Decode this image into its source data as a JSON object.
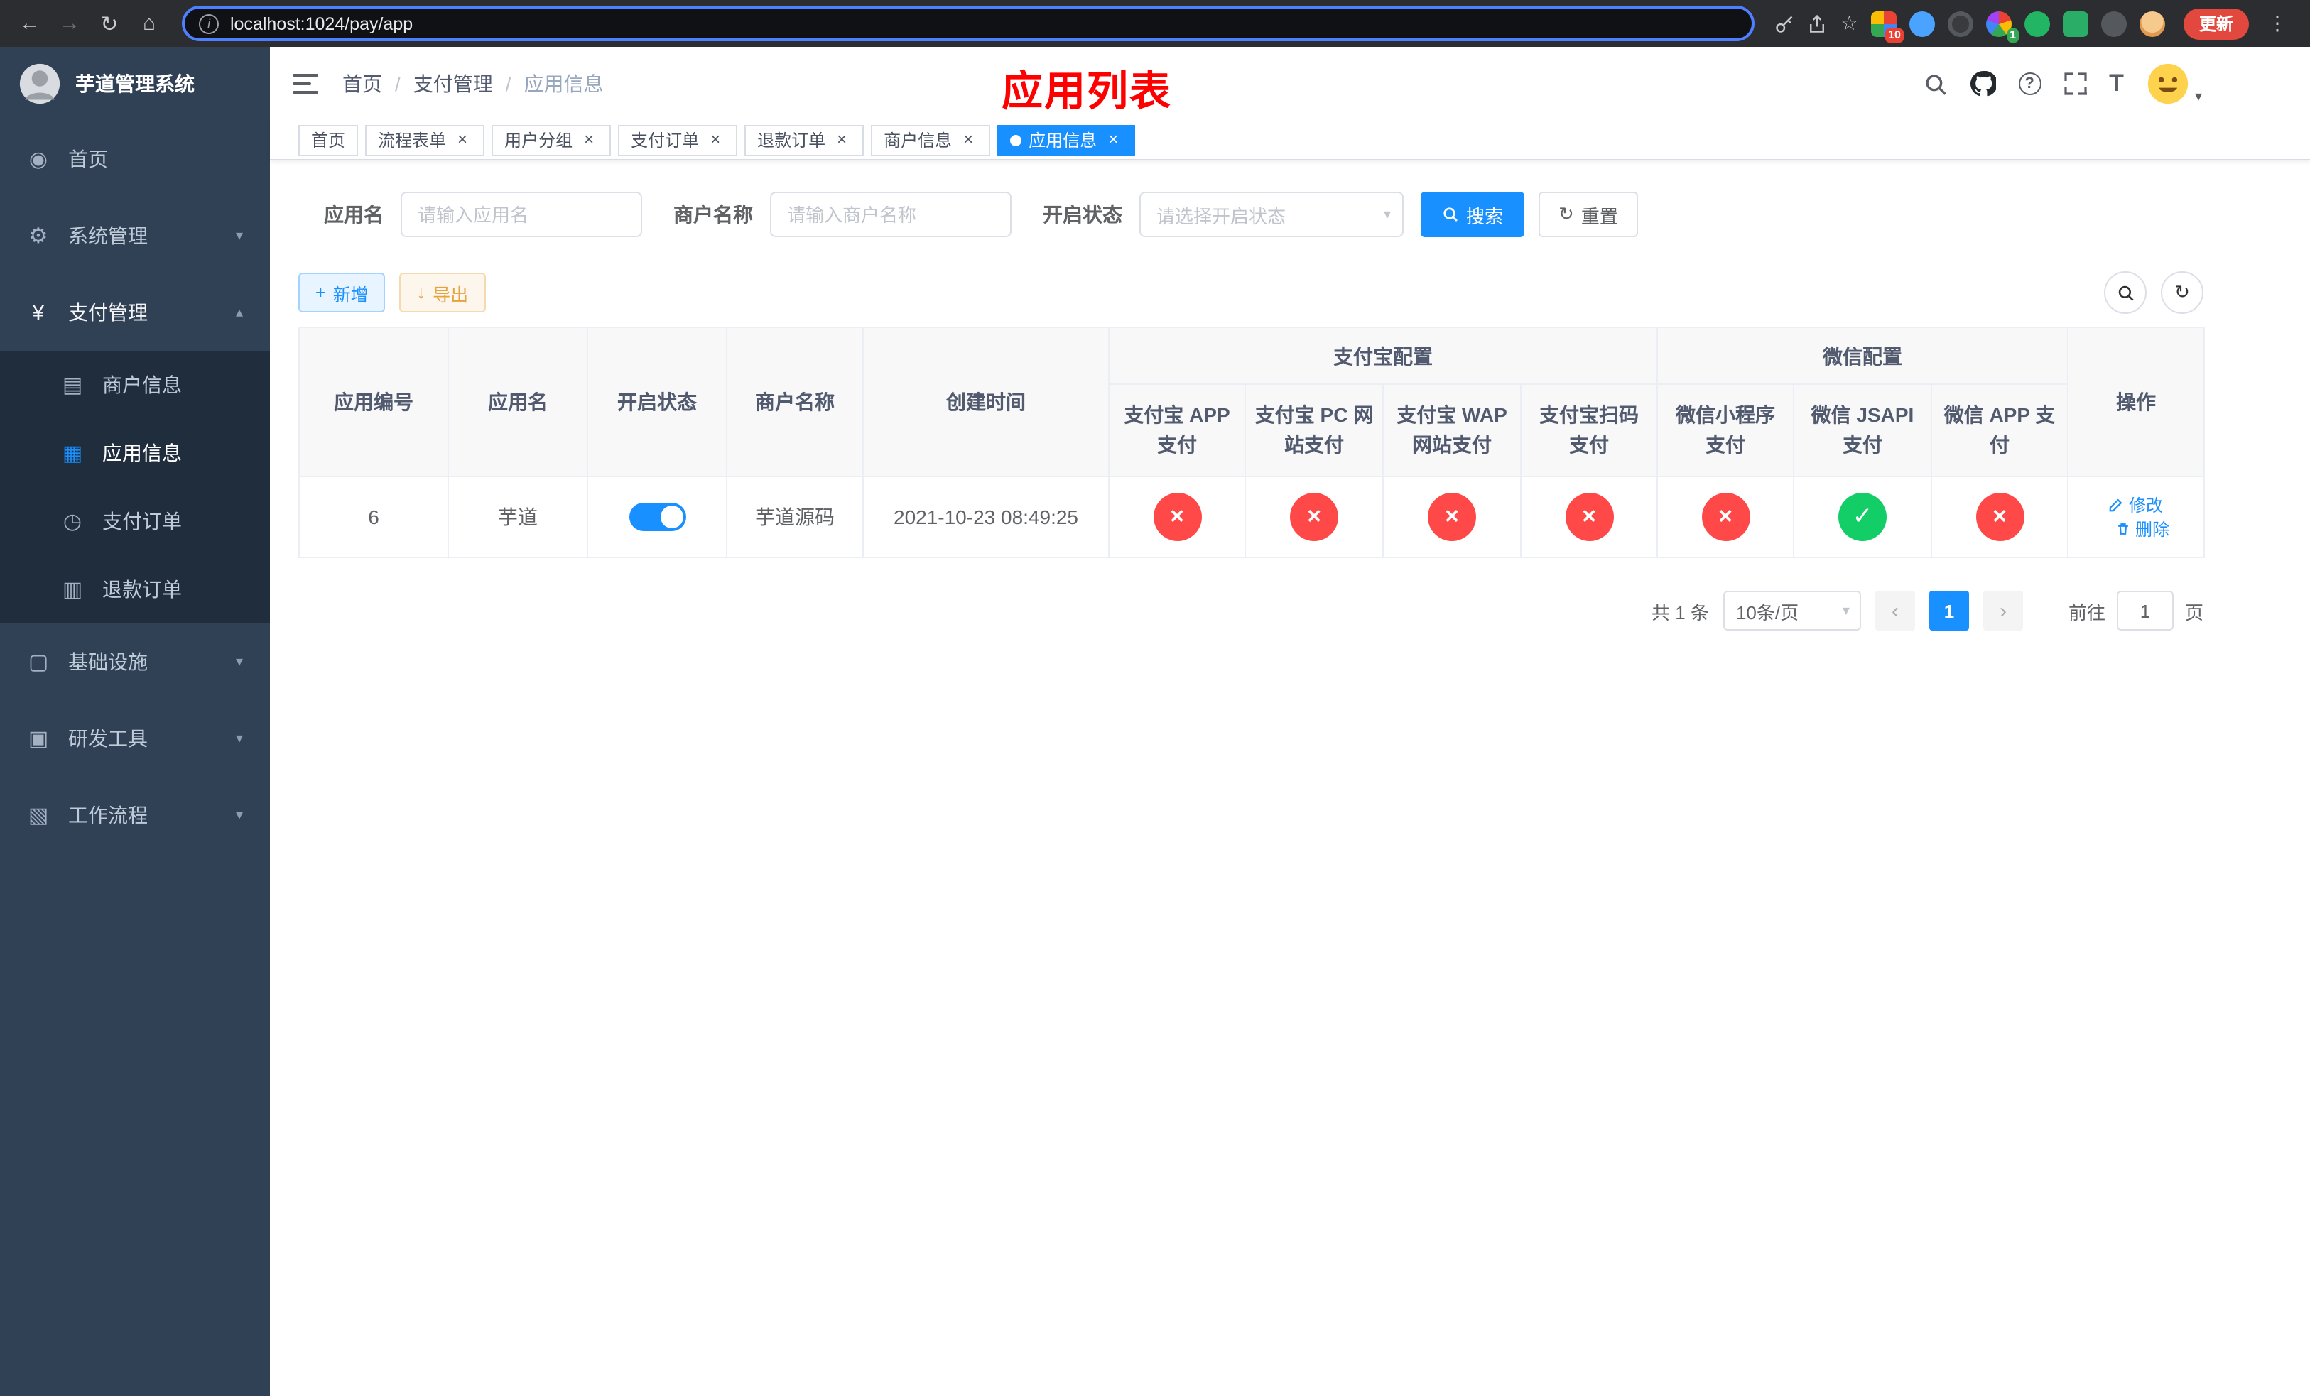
{
  "colors": {
    "primary": "#1890ff",
    "danger": "#ff4949",
    "success": "#13ce66",
    "warning": "#e6a23c",
    "annotation": "#ff0000"
  },
  "browser": {
    "url": "localhost:1024/pay/app",
    "update_button": "更新",
    "ext_badge_grid": "10",
    "ext_badge_wheel": "1"
  },
  "icons": {
    "back": "←",
    "forward": "→",
    "reload": "↻",
    "home": "⌂",
    "info": "i",
    "star": "☆",
    "dots": "⋮",
    "sep": "/",
    "chevron_down": "▾",
    "chevron_up": "▴",
    "caret": "▾",
    "close": "×",
    "cross": "×",
    "check": "✓",
    "prev": "‹",
    "next": "›",
    "plus": "+",
    "download": "↓",
    "refresh": "↻",
    "question": "?",
    "text_size": "T",
    "menu_home": "◉",
    "menu_system": "⚙",
    "menu_pay": "¥",
    "menu_merchant": "▤",
    "menu_app": "▦",
    "menu_pay_order": "◷",
    "menu_refund": "▥",
    "menu_infra": "▢",
    "menu_tools": "▣",
    "menu_flow": "▧"
  },
  "sidebar": {
    "title": "芋道管理系统",
    "menu": [
      {
        "label": "首页"
      },
      {
        "label": "系统管理"
      },
      {
        "label": "支付管理"
      },
      {
        "label": "商户信息"
      },
      {
        "label": "应用信息"
      },
      {
        "label": "支付订单"
      },
      {
        "label": "退款订单"
      },
      {
        "label": "基础设施"
      },
      {
        "label": "研发工具"
      },
      {
        "label": "工作流程"
      }
    ]
  },
  "navbar": {
    "breadcrumb": [
      {
        "label": "首页"
      },
      {
        "label": "支付管理"
      },
      {
        "label": "应用信息"
      }
    ],
    "annotation": "应用列表"
  },
  "tabs": [
    {
      "label": "首页",
      "closable": false,
      "active": false
    },
    {
      "label": "流程表单",
      "closable": true,
      "active": false
    },
    {
      "label": "用户分组",
      "closable": true,
      "active": false
    },
    {
      "label": "支付订单",
      "closable": true,
      "active": false
    },
    {
      "label": "退款订单",
      "closable": true,
      "active": false
    },
    {
      "label": "商户信息",
      "closable": true,
      "active": false
    },
    {
      "label": "应用信息",
      "closable": true,
      "active": true
    }
  ],
  "filters": {
    "app_name_label": "应用名",
    "app_name_placeholder": "请输入应用名",
    "merchant_label": "商户名称",
    "merchant_placeholder": "请输入商户名称",
    "status_label": "开启状态",
    "status_placeholder": "请选择开启状态",
    "search_button": "搜索",
    "reset_button": "重置"
  },
  "toolbar": {
    "add_button": "新增",
    "export_button": "导出"
  },
  "table": {
    "group_headers": {
      "alipay": "支付宝配置",
      "wechat": "微信配置"
    },
    "columns": {
      "app_id": "应用编号",
      "app_name": "应用名",
      "status": "开启状态",
      "merchant_name": "商户名称",
      "create_time": "创建时间",
      "alipay_app": "支付宝 APP 支付",
      "alipay_pc": "支付宝 PC 网站支付",
      "alipay_wap": "支付宝 WAP 网站支付",
      "alipay_qr": "支付宝扫码支付",
      "wx_mini": "微信小程序支付",
      "wx_jsapi": "微信 JSAPI 支付",
      "wx_app": "微信 APP 支付",
      "actions": "操作"
    },
    "rows": [
      {
        "app_id": "6",
        "app_name": "芋道",
        "status_enabled": true,
        "merchant_name": "芋道源码",
        "create_time": "2021-10-23 08:49:25",
        "channels": {
          "alipay_app": false,
          "alipay_pc": false,
          "alipay_wap": false,
          "alipay_qr": false,
          "wx_mini": false,
          "wx_jsapi": true,
          "wx_app": false
        },
        "edit_label": "修改",
        "delete_label": "删除"
      }
    ]
  },
  "pagination": {
    "total_text": "共 1 条",
    "page_size_text": "10条/页",
    "current_page": "1",
    "goto_label": "前往",
    "goto_value": "1",
    "goto_suffix": "页"
  }
}
